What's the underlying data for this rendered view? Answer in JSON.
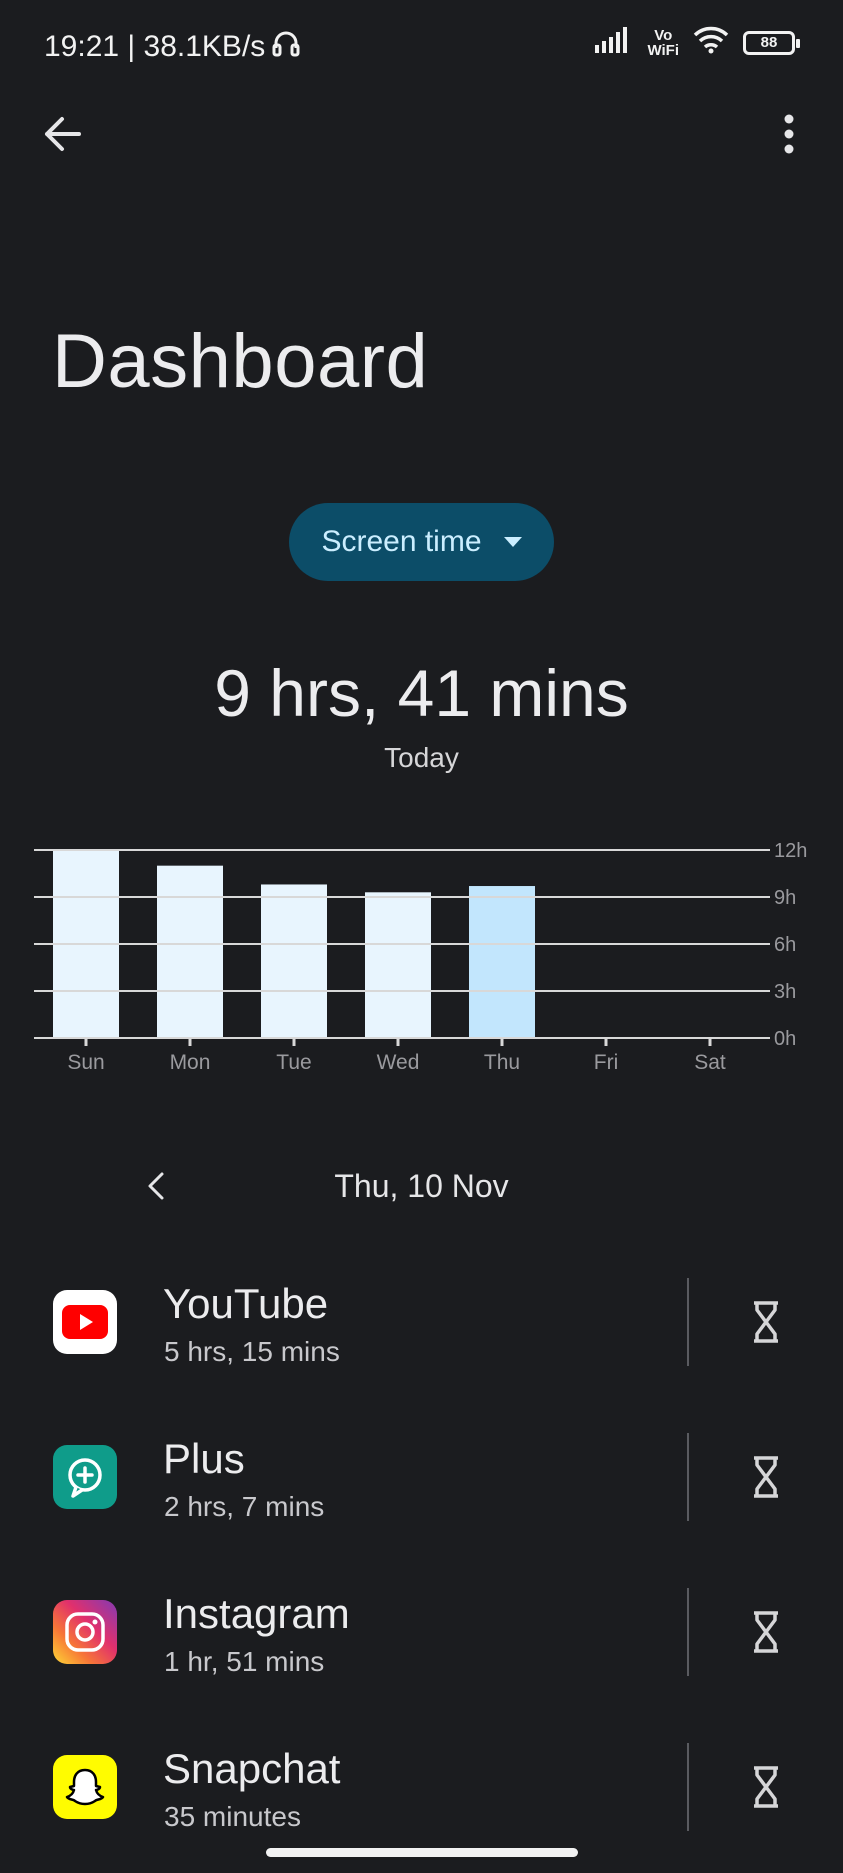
{
  "status_bar": {
    "time_speed": "19:21 | 38.1KB/s",
    "vowifi_top": "Vo",
    "vowifi_bottom": "WiFi",
    "battery": "88"
  },
  "header": {
    "title": "Dashboard",
    "selector_label": "Screen time"
  },
  "summary": {
    "total": "9 hrs, 41 mins",
    "caption": "Today"
  },
  "chart_data": {
    "type": "bar",
    "categories": [
      "Sun",
      "Mon",
      "Tue",
      "Wed",
      "Thu",
      "Fri",
      "Sat"
    ],
    "values": [
      12.0,
      11.0,
      9.8,
      9.3,
      9.7,
      0,
      0
    ],
    "y_ticks": [
      "0h",
      "3h",
      "6h",
      "9h",
      "12h"
    ],
    "ylim": [
      0,
      12
    ],
    "grid": true,
    "selected_index": 4,
    "colors": {
      "bar": "#e8f5fe",
      "selected_bar": "#c2e6fd",
      "grid": "#d8d8d8",
      "tick_label": "#9a9a9e"
    }
  },
  "date_nav": {
    "label": "Thu, 10 Nov"
  },
  "apps": [
    {
      "name": "YouTube",
      "time": "5 hrs, 15 mins",
      "icon": "youtube-icon"
    },
    {
      "name": "Plus",
      "time": "2 hrs, 7 mins",
      "icon": "plus-messenger-icon"
    },
    {
      "name": "Instagram",
      "time": "1 hr, 51 mins",
      "icon": "instagram-icon"
    },
    {
      "name": "Snapchat",
      "time": "35 minutes",
      "icon": "snapchat-icon"
    }
  ]
}
